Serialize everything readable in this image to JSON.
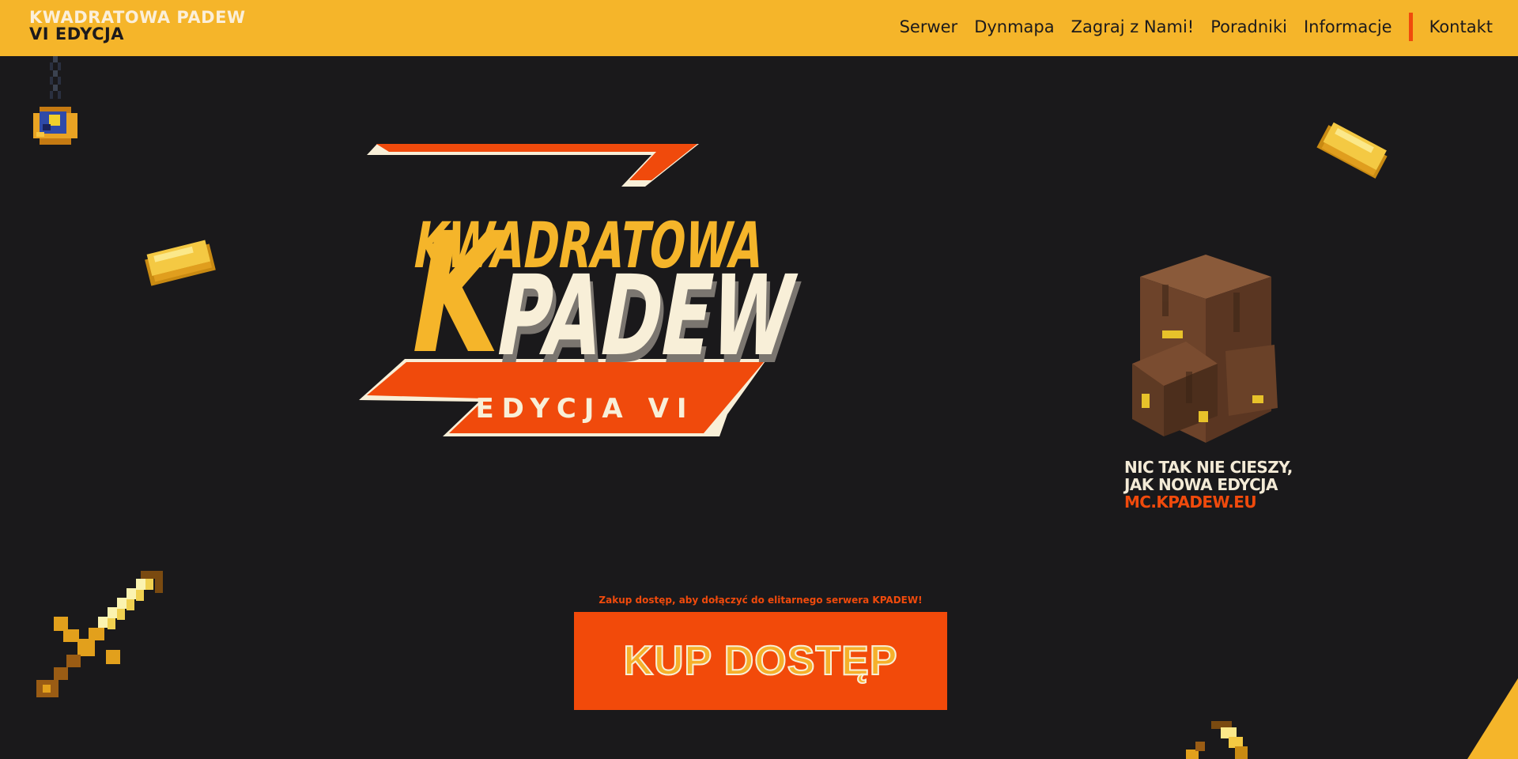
{
  "brand": {
    "line1": "KWADRATOWA PADEW",
    "line2": "VI EDYCJA"
  },
  "nav": {
    "items": [
      "Serwer",
      "Dynmapa",
      "Zagraj z Nami!",
      "Poradniki",
      "Informacje"
    ],
    "contact": "Kontakt"
  },
  "logo": {
    "word1": "KWADRATOWA",
    "word2": "PADEW",
    "k_letter": "K",
    "edition": "EDYCJA VI"
  },
  "promo": {
    "line1": "NIC TAK NIE CIESZY,",
    "line2": "JAK NOWA EDYCJA",
    "line3": "MC.KPADEW.EU"
  },
  "cta": {
    "note": "Zakup dostęp, aby dołączyć do elitarnego serwera KPADEW!",
    "button_label": "KUP DOSTĘP"
  },
  "colors": {
    "bar": "#f5b52a",
    "accent": "#f04a0c",
    "background": "#1a191b",
    "cream": "#f8efd8"
  },
  "icons": [
    "amulet-icon",
    "gold-ingot-icon",
    "gold-sword-icon",
    "backpack-icon",
    "gold-pickaxe-icon"
  ]
}
